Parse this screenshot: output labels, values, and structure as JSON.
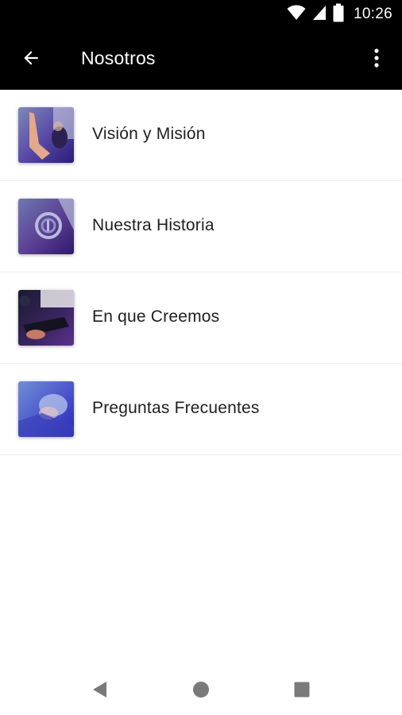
{
  "status_bar": {
    "time": "10:26",
    "icons": [
      "wifi-icon",
      "signal-icon",
      "battery-icon"
    ]
  },
  "app_bar": {
    "title": "Nosotros",
    "back_icon": "arrow-back-icon",
    "overflow_icon": "more-vert-icon"
  },
  "menu": {
    "items": [
      {
        "label": "Visión y Misión",
        "thumbnail": "worship-photo"
      },
      {
        "label": "Nuestra Historia",
        "thumbnail": "logo-sign-photo"
      },
      {
        "label": "En que Creemos",
        "thumbnail": "bible-photo"
      },
      {
        "label": "Preguntas Frecuentes",
        "thumbnail": "prayer-photo"
      }
    ]
  },
  "nav_bar": {
    "icons": [
      "nav-back-icon",
      "nav-home-icon",
      "nav-recents-icon"
    ]
  },
  "colors": {
    "app_bar_bg": "#000000",
    "text_primary": "#1f1f1f",
    "divider": "#ececec",
    "nav_icon": "#7a7a7a",
    "thumb_tint": "#4a35c9"
  }
}
